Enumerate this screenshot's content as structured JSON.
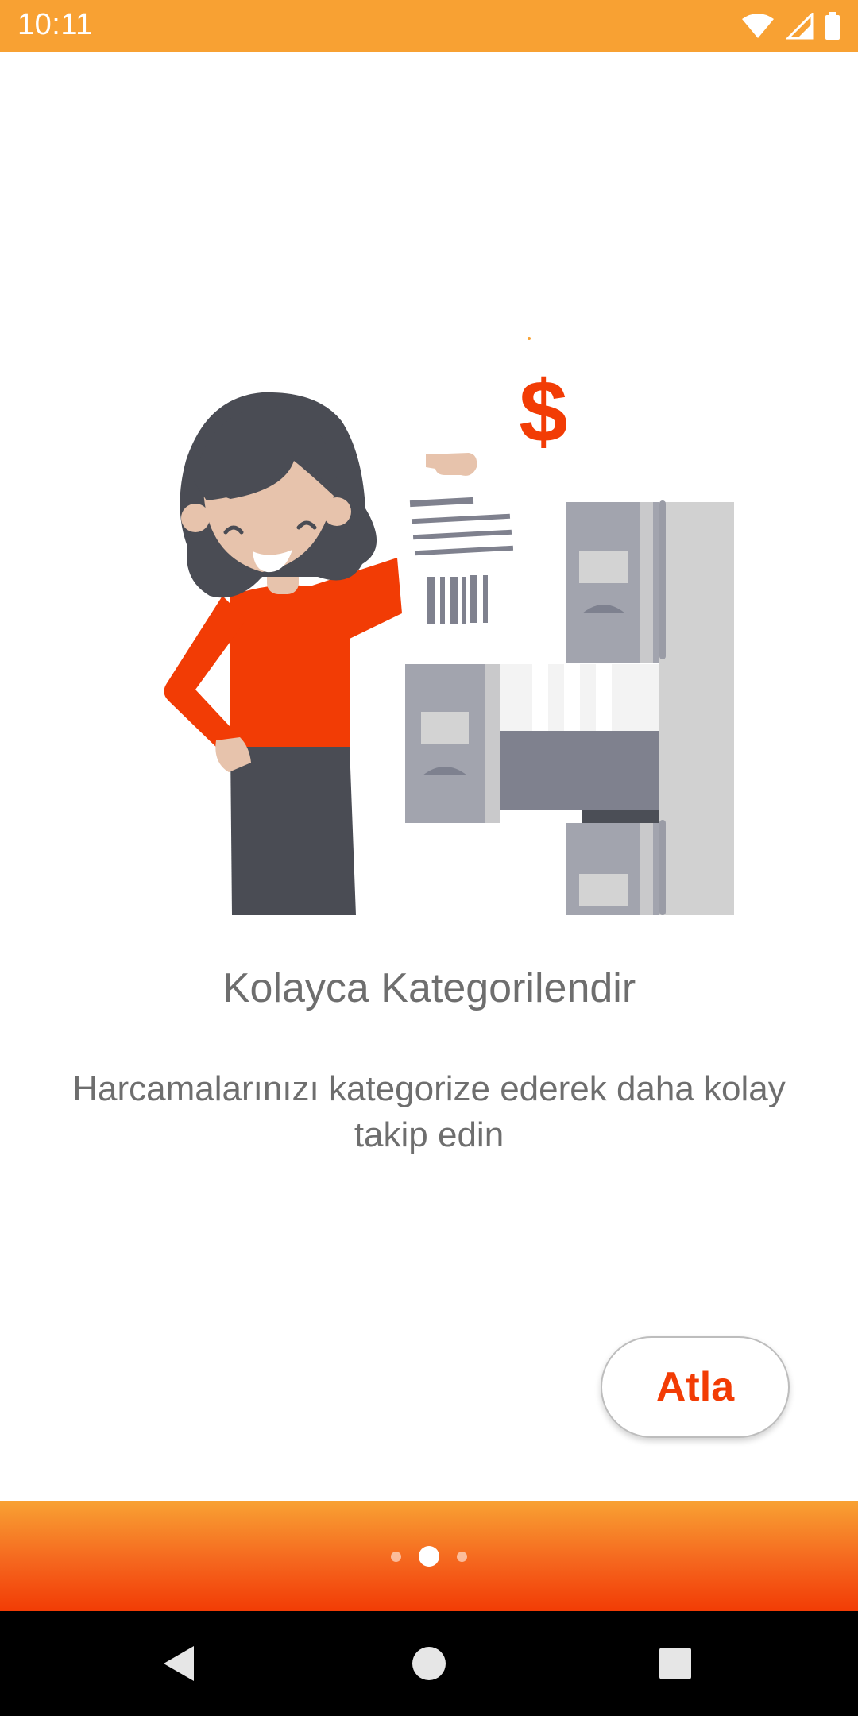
{
  "status_bar": {
    "time": "10:11",
    "icons": [
      "wifi-icon",
      "signal-icon",
      "battery-icon"
    ],
    "background": "#F8A133"
  },
  "onboarding": {
    "title": "Kolayca Kategorilendir",
    "subtitle": "Harcamalarınızı kategorize ederek daha kolay takip edin",
    "illustration_currency_symbol": "$"
  },
  "skip_button": {
    "label": "Atla",
    "color": "#F23C05"
  },
  "page_indicator": {
    "total": 3,
    "active_index": 1
  },
  "nav_bar": {
    "buttons": [
      "back-icon",
      "home-icon",
      "recent-apps-icon"
    ]
  },
  "colors": {
    "accent": "#F23C05",
    "gradient_start": "#F8A133",
    "gradient_end": "#F23C05",
    "text": "#6E6E6E"
  }
}
